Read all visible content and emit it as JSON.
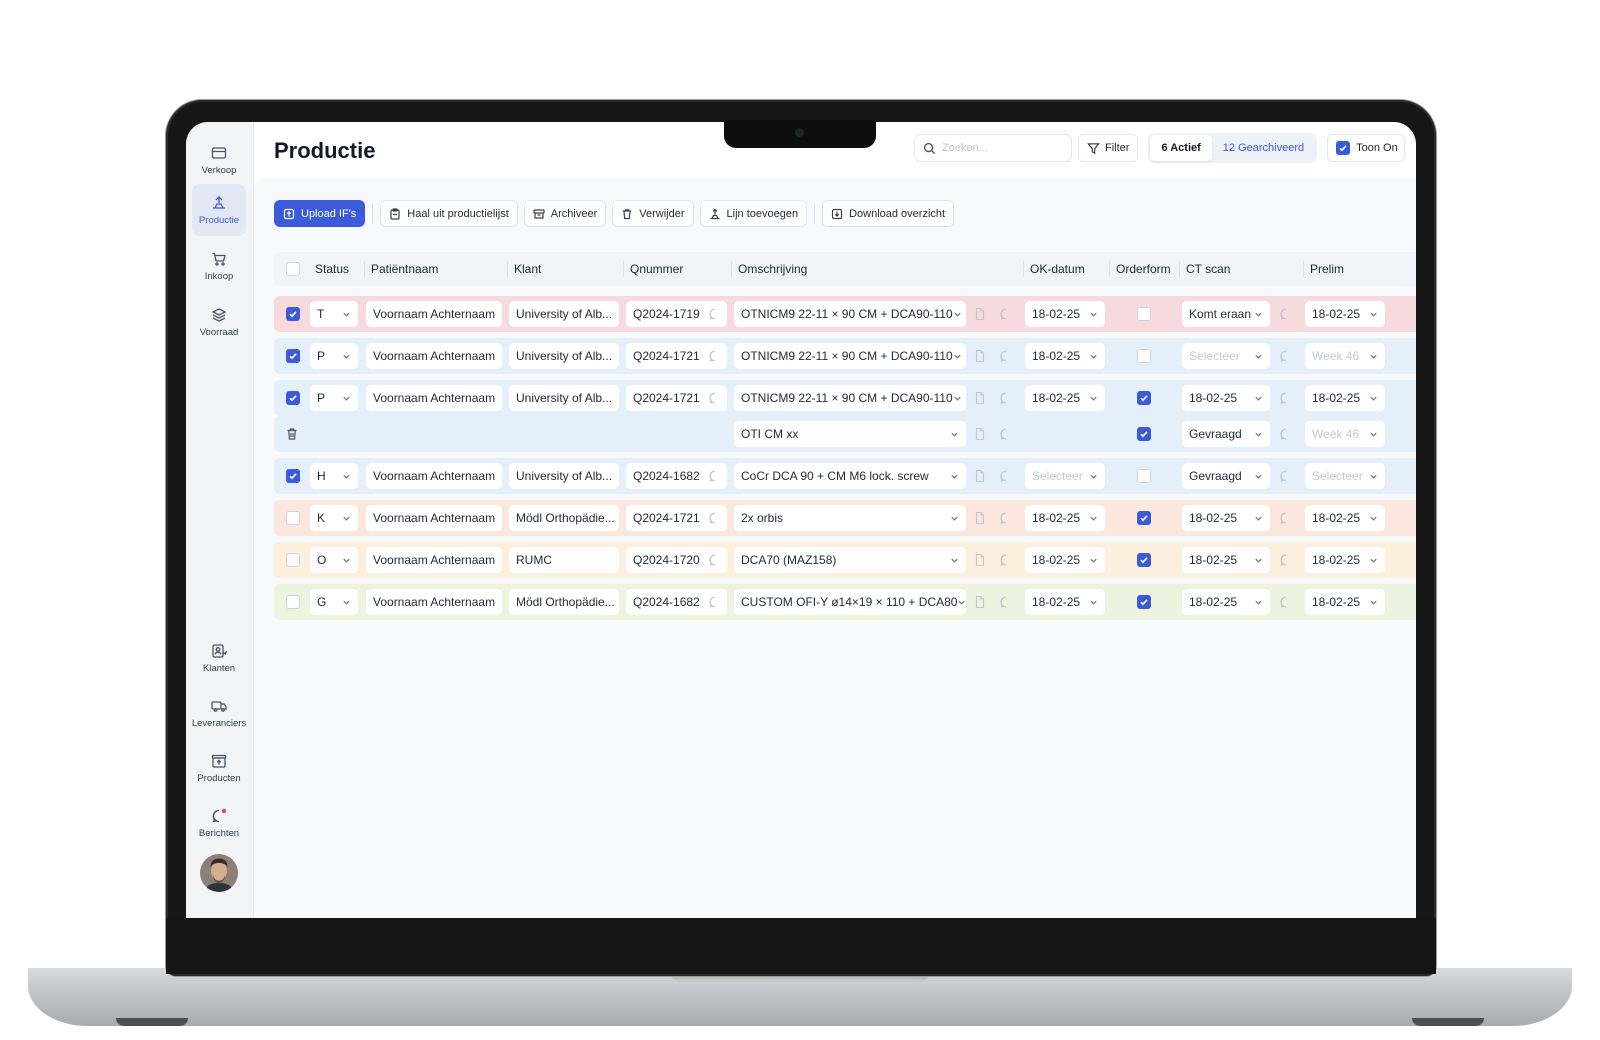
{
  "sidebar": {
    "items": [
      {
        "label": "Verkoop",
        "icon": "wallet-icon"
      },
      {
        "label": "Productie",
        "icon": "production-icon"
      },
      {
        "label": "Inkoop",
        "icon": "cart-icon"
      },
      {
        "label": "Voorraad",
        "icon": "stack-icon"
      }
    ],
    "bottom_items": [
      {
        "label": "Klanten",
        "icon": "clients-icon"
      },
      {
        "label": "Leveranciers",
        "icon": "truck-icon"
      },
      {
        "label": "Producten",
        "icon": "box-icon"
      },
      {
        "label": "Berichten",
        "icon": "chat-icon"
      }
    ]
  },
  "header": {
    "title": "Productie",
    "search_placeholder": "Zoeken...",
    "filter_label": "Filter",
    "active_label": "6 Actief",
    "archived_label": "12 Gearchiveerd",
    "toon_label": "Toon On"
  },
  "toolbar": {
    "upload": "Upload IF's",
    "haal_uit": "Haal uit productielijst",
    "archiveer": "Archiveer",
    "verwijder": "Verwijder",
    "lijn": "Lijn toevoegen",
    "download": "Download overzicht"
  },
  "columns": {
    "status": "Status",
    "patient": "Patiëntnaam",
    "klant": "Klant",
    "qnummer": "Qnummer",
    "omschrijving": "Omschrijving",
    "ok_datum": "OK-datum",
    "orderform": "Orderform",
    "ct_scan": "CT scan",
    "prelim": "Prelim"
  },
  "colors": {
    "accent": "#3b5bdb",
    "row_red": "#f6dadd",
    "row_blue": "#e5eff9",
    "row_peach": "#fbe7de",
    "row_orange": "#fcefde",
    "row_green": "#eef3df"
  },
  "rows": [
    {
      "checked": true,
      "status": "T",
      "patient": "Voornaam Achternaam",
      "klant": "University of Alb...",
      "qnummer": "Q2024-1719",
      "omschrijving": "OTNICM9 22-11 × 90 CM + DCA90-110",
      "ok_datum": "18-02-25",
      "orderform": false,
      "ct_scan": "Komt eraan",
      "prelim": "18-02-25"
    },
    {
      "checked": true,
      "status": "P",
      "patient": "Voornaam Achternaam",
      "klant": "University of Alb...",
      "qnummer": "Q2024-1721",
      "omschrijving": "OTNICM9 22-11 × 90 CM + DCA90-110",
      "ok_datum": "18-02-25",
      "orderform": false,
      "ct_scan": "Selecteer",
      "prelim": "Week 46"
    },
    {
      "checked": true,
      "status": "P",
      "patient": "Voornaam Achternaam",
      "klant": "University of Alb...",
      "qnummer": "Q2024-1721",
      "omschrijving": "OTNICM9 22-11 × 90 CM + DCA90-110",
      "ok_datum": "18-02-25",
      "orderform": true,
      "ct_scan": "18-02-25",
      "prelim": "18-02-25"
    },
    {
      "sub": true,
      "omschrijving": "OTI CM xx",
      "orderform": true,
      "ct_scan": "Gevraagd",
      "prelim": "Week 46"
    },
    {
      "checked": true,
      "status": "H",
      "patient": "Voornaam Achternaam",
      "klant": "University of Alb...",
      "qnummer": "Q2024-1682",
      "omschrijving": "CoCr DCA 90 + CM M6 lock. screw",
      "ok_datum": "Selecteer",
      "orderform": false,
      "ct_scan": "Gevraagd",
      "prelim": "Selecteer"
    },
    {
      "checked": false,
      "status": "K",
      "patient": "Voornaam Achternaam",
      "klant": "Mödl Orthopädie...",
      "qnummer": "Q2024-1721",
      "omschrijving": "2x orbis",
      "ok_datum": "18-02-25",
      "orderform": true,
      "ct_scan": "18-02-25",
      "prelim": "18-02-25"
    },
    {
      "checked": false,
      "status": "O",
      "patient": "Voornaam Achternaam",
      "klant": "RUMC",
      "qnummer": "Q2024-1720",
      "omschrijving": "DCA70  (MAZ158)",
      "ok_datum": "18-02-25",
      "orderform": true,
      "ct_scan": "18-02-25",
      "prelim": "18-02-25"
    },
    {
      "checked": false,
      "status": "G",
      "patient": "Voornaam Achternaam",
      "klant": "Mödl Orthopädie...",
      "qnummer": "Q2024-1682",
      "omschrijving": "CUSTOM OFI-Y ø14×19 × 110 + DCA80",
      "ok_datum": "18-02-25",
      "orderform": true,
      "ct_scan": "18-02-25",
      "prelim": "18-02-25"
    }
  ]
}
